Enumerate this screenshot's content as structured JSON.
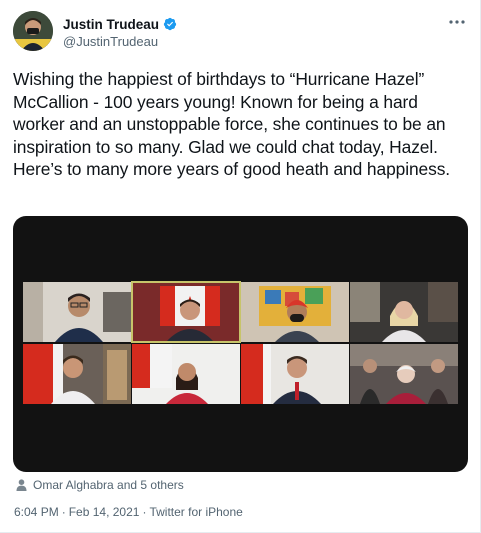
{
  "author": {
    "display_name": "Justin Trudeau",
    "handle": "@JustinTrudeau",
    "verified": true,
    "avatar_icon": "profile-photo"
  },
  "tweet": {
    "text": "Wishing the happiest of birthdays to “Hurricane Hazel” McCallion - 100 years young! Known for being a hard worker and an unstoppable force, she continues to be an inspiration to so many. Glad we could chat today, Hazel. Here’s to many more years of good heath and happiness."
  },
  "media": {
    "type": "video-call-screenshot",
    "tiles": 8
  },
  "likes": {
    "text": "Omar Alghabra and 5 others",
    "icon": "person-icon"
  },
  "meta": {
    "time": "6:04 PM",
    "date": "Feb 14, 2021",
    "source": "Twitter for iPhone"
  },
  "colors": {
    "verified": "#1d9bf0",
    "secondary_text": "#536471",
    "media_bg": "#121212"
  }
}
